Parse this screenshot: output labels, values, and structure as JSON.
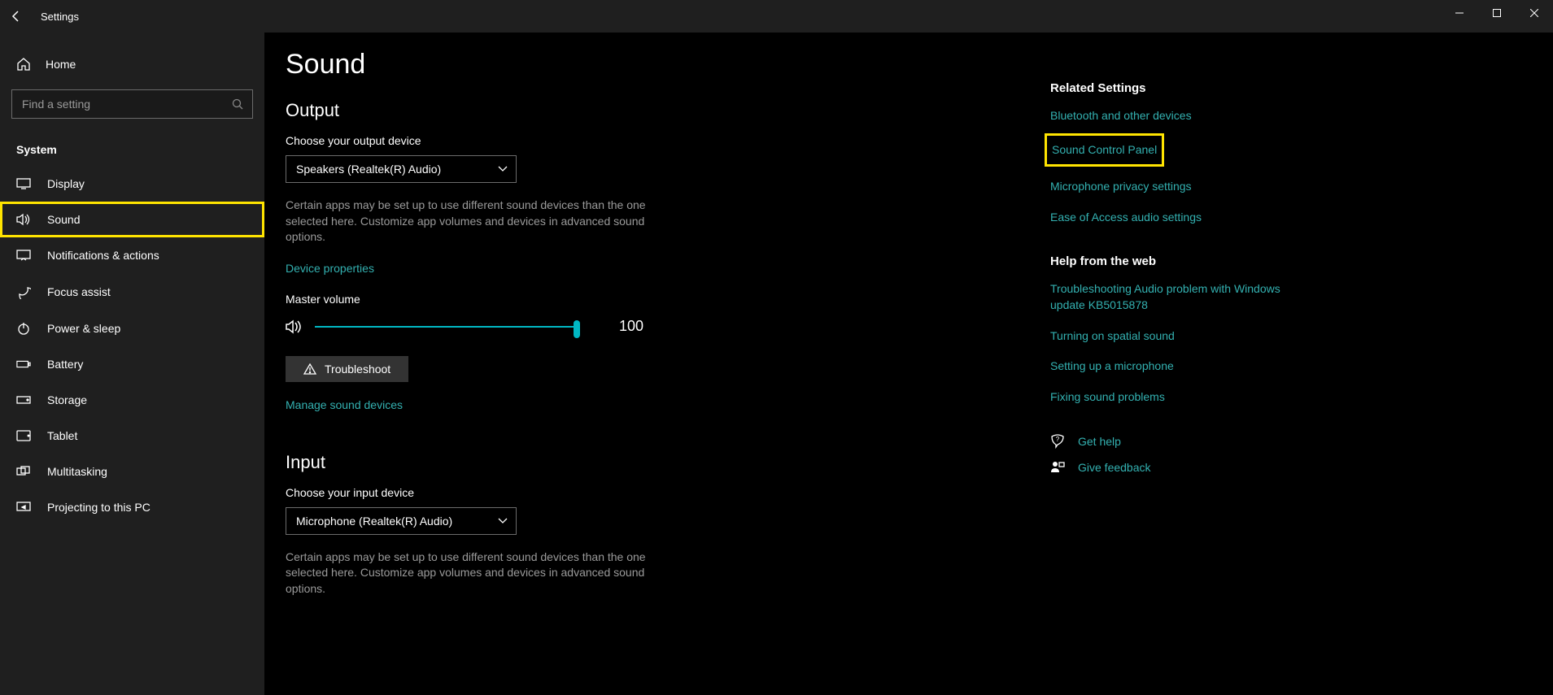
{
  "titlebar": {
    "title": "Settings"
  },
  "sidebar": {
    "home_label": "Home",
    "search_placeholder": "Find a setting",
    "category": "System",
    "items": [
      {
        "label": "Display"
      },
      {
        "label": "Sound"
      },
      {
        "label": "Notifications & actions"
      },
      {
        "label": "Focus assist"
      },
      {
        "label": "Power & sleep"
      },
      {
        "label": "Battery"
      },
      {
        "label": "Storage"
      },
      {
        "label": "Tablet"
      },
      {
        "label": "Multitasking"
      },
      {
        "label": "Projecting to this PC"
      }
    ]
  },
  "page": {
    "title": "Sound",
    "output": {
      "heading": "Output",
      "choose_label": "Choose your output device",
      "selected": "Speakers (Realtek(R) Audio)",
      "desc": "Certain apps may be set up to use different sound devices than the one selected here. Customize app volumes and devices in advanced sound options.",
      "device_properties": "Device properties",
      "master_label": "Master volume",
      "volume_value": "100",
      "troubleshoot": "Troubleshoot",
      "manage": "Manage sound devices"
    },
    "input": {
      "heading": "Input",
      "choose_label": "Choose your input device",
      "selected": "Microphone (Realtek(R) Audio)",
      "desc": "Certain apps may be set up to use different sound devices than the one selected here. Customize app volumes and devices in advanced sound options."
    }
  },
  "rail": {
    "related_heading": "Related Settings",
    "related_links": {
      "bluetooth": "Bluetooth and other devices",
      "control_panel": "Sound Control Panel",
      "mic_privacy": "Microphone privacy settings",
      "ease": "Ease of Access audio settings"
    },
    "help_heading": "Help from the web",
    "help_links": {
      "kb": "Troubleshooting Audio problem with Windows update KB5015878",
      "spatial": "Turning on spatial sound",
      "mic": "Setting up a microphone",
      "fix": "Fixing sound problems"
    },
    "get_help": "Get help",
    "feedback": "Give feedback"
  }
}
